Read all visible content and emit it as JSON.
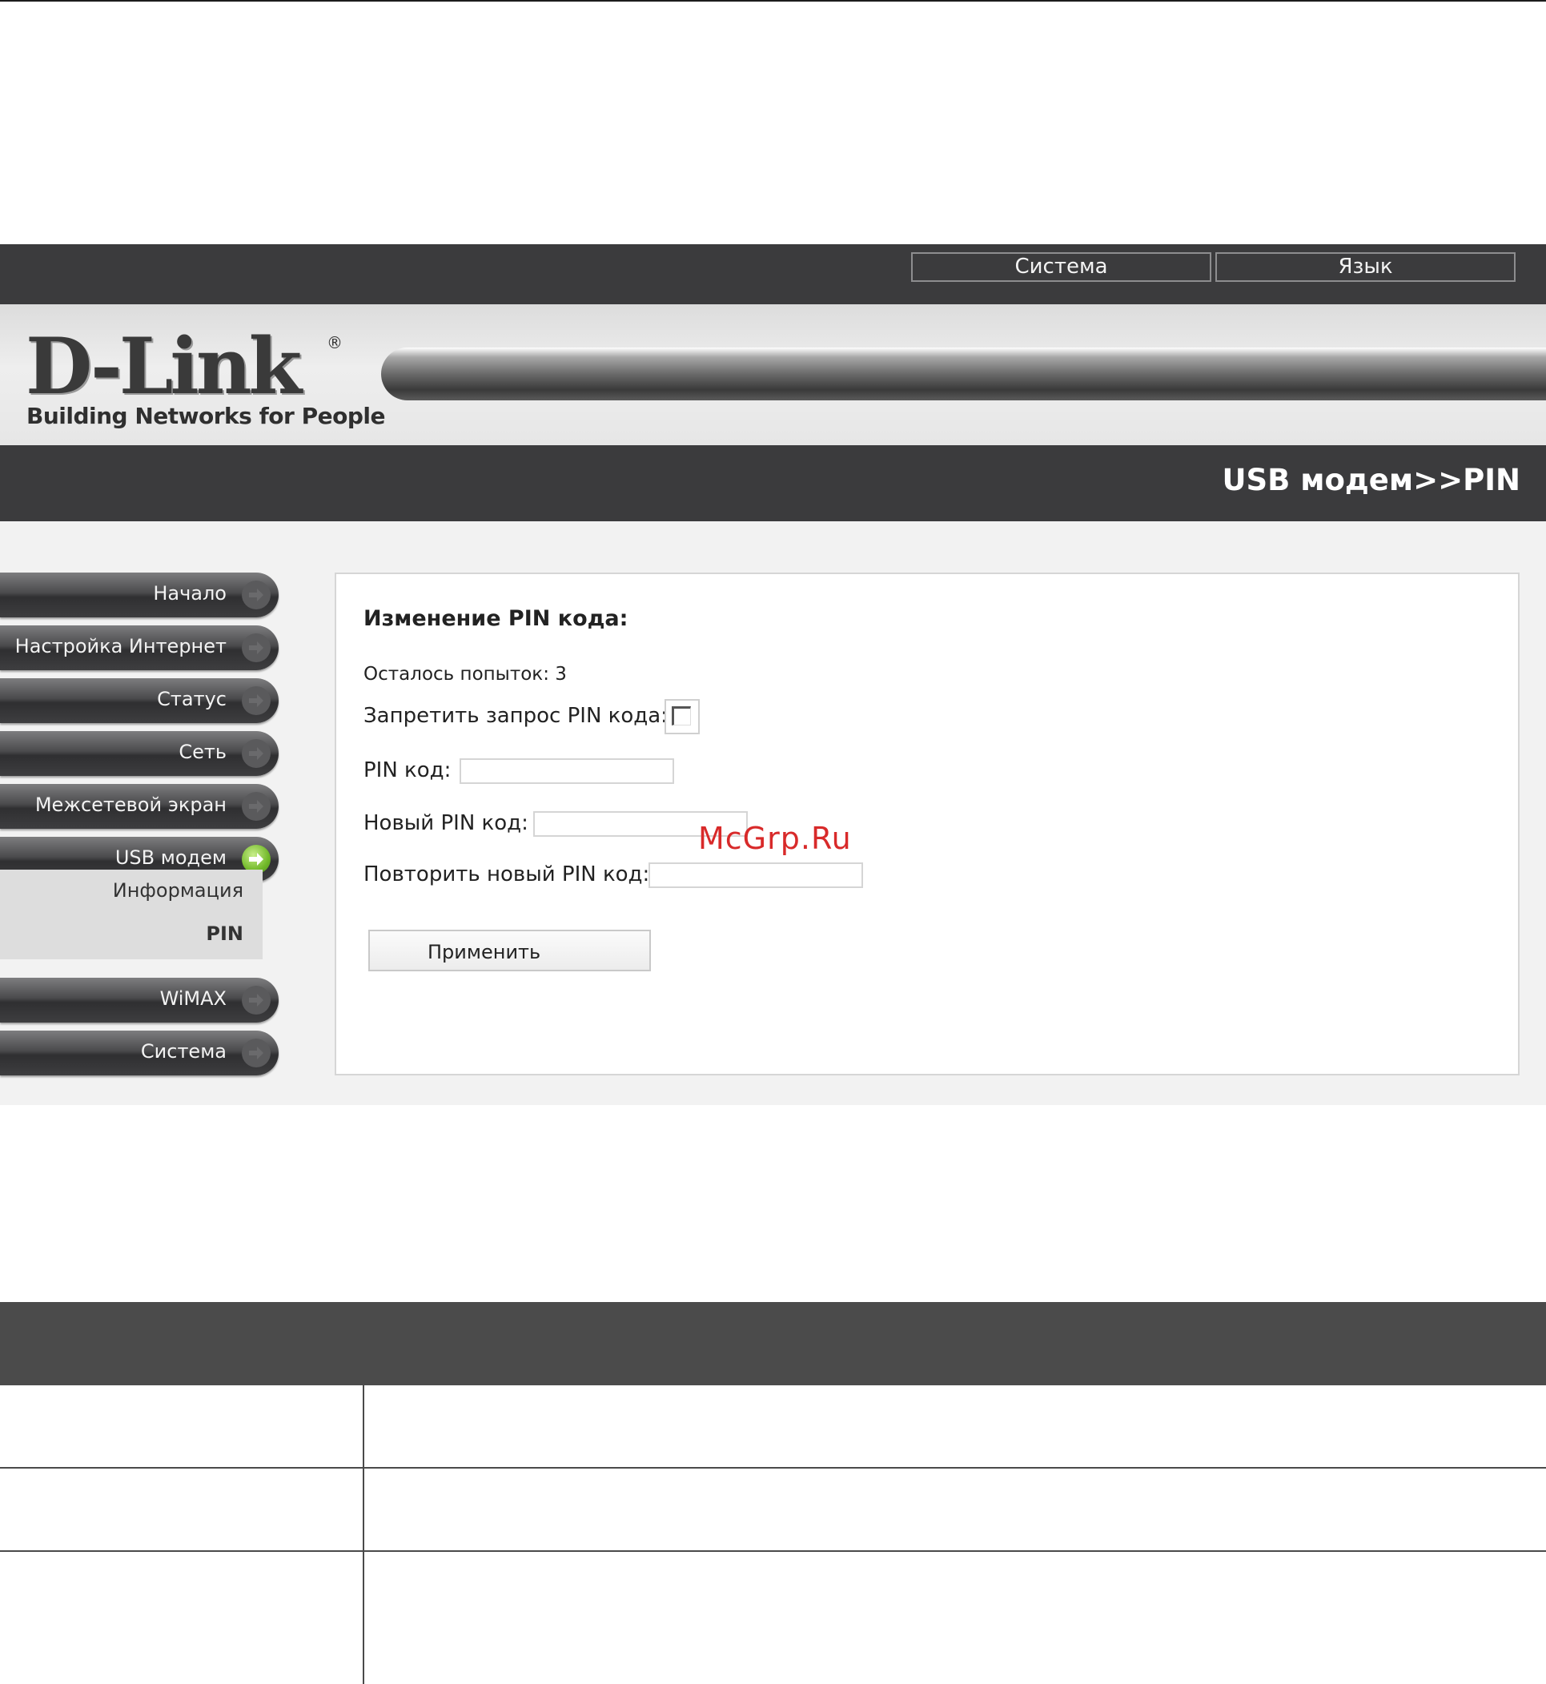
{
  "topbar": {
    "system_label": "Система",
    "language_label": "Язык"
  },
  "brand": {
    "logo_text": "D-Link",
    "registered_mark": "®",
    "tagline": "Building Networks for People"
  },
  "page_title": "USB модем>>PIN",
  "sidebar": {
    "items": [
      {
        "label": "Начало"
      },
      {
        "label": "Настройка Интернет"
      },
      {
        "label": "Статус"
      },
      {
        "label": "Сеть"
      },
      {
        "label": "Межсетевой экран"
      },
      {
        "label": "USB модем",
        "active": true
      },
      {
        "label": "WiMAX"
      },
      {
        "label": "Система"
      }
    ],
    "submenu": [
      {
        "label": "Информация"
      },
      {
        "label": "PIN",
        "selected": true
      }
    ]
  },
  "form": {
    "heading": "Изменение PIN кода:",
    "attempts_left": "Осталось попыток: 3",
    "disable_pin_label": "Запретить запрос PIN кода:",
    "disable_pin_checked": false,
    "pin_label": "PIN код:",
    "pin_value": "",
    "new_pin_label": "Новый PIN код:",
    "new_pin_value": "",
    "repeat_pin_label": "Повторить новый PIN код:",
    "repeat_pin_value": "",
    "apply_label": "Применить"
  },
  "watermark": "McGrp.Ru",
  "colors": {
    "dark_bar": "#3b3b3d",
    "active_arrow": "#72b92a",
    "watermark": "#d82a2a",
    "table_header": "#4b4b4b"
  },
  "icons": [
    "arrow-right-icon",
    "checkbox-icon"
  ]
}
